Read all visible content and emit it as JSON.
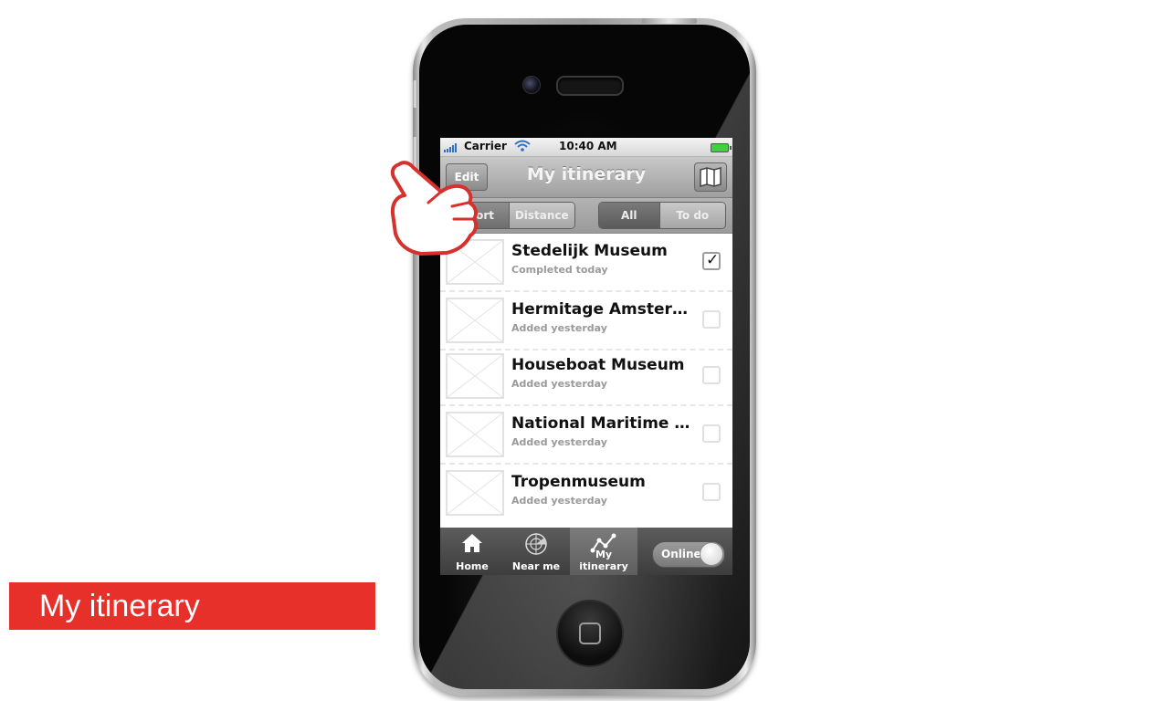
{
  "slide": {
    "label": "My itinerary"
  },
  "status": {
    "carrier": "Carrier",
    "time": "10:40 AM"
  },
  "nav": {
    "left_button": "Edit",
    "title": "My itinerary"
  },
  "filters": {
    "sort": [
      "Sort order",
      "Distance"
    ],
    "view": [
      "All",
      "To do"
    ]
  },
  "items": [
    {
      "title": "Stedelijk Museum",
      "subtitle": "Completed today",
      "checked": true
    },
    {
      "title": "Hermitage Amsterdam",
      "subtitle": "Added yesterday",
      "checked": false
    },
    {
      "title": "Houseboat Museum",
      "subtitle": "Added yesterday",
      "checked": false
    },
    {
      "title": "National Maritime Museum",
      "subtitle": "Added yesterday",
      "checked": false
    },
    {
      "title": "Tropenmuseum",
      "subtitle": "Added yesterday",
      "checked": false
    }
  ],
  "check_mark": "✓",
  "tabs": [
    {
      "label": "Home",
      "icon": "home-icon"
    },
    {
      "label": "Near me",
      "icon": "radar-icon"
    },
    {
      "label": "My itinerary",
      "icon": "route-icon"
    }
  ],
  "toggle": {
    "label": "Online"
  },
  "colors": {
    "accent": "#e8302a"
  }
}
